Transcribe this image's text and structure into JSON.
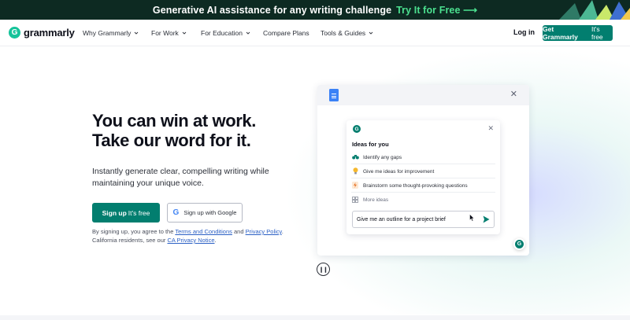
{
  "banner": {
    "text": "Generative AI assistance for any writing challenge",
    "cta": "Try It for Free ⟶"
  },
  "nav": {
    "logo_mark": "G",
    "logo_text": "grammarly",
    "items": [
      {
        "label": "Why Grammarly",
        "has_dropdown": true
      },
      {
        "label": "For Work",
        "has_dropdown": true
      },
      {
        "label": "For Education",
        "has_dropdown": true
      },
      {
        "label": "Compare Plans",
        "has_dropdown": false
      },
      {
        "label": "Tools & Guides",
        "has_dropdown": true
      }
    ],
    "login": "Log in",
    "cta_bold": "Get Grammarly",
    "cta_light": "It's free"
  },
  "hero": {
    "headline_line1": "You can win at work.",
    "headline_line2": "Take our word for it.",
    "subtext": "Instantly generate clear, compelling writing while maintaining your unique voice.",
    "signup_bold": "Sign up",
    "signup_light": "It's free",
    "google_label": "Sign up with Google",
    "legal": {
      "p1": "By signing up, you agree to the ",
      "terms": "Terms and Conditions",
      "p2": " and ",
      "privacy": "Privacy Policy",
      "p3": ". California residents, see our ",
      "ca": "CA Privacy Notice",
      "p4": "."
    }
  },
  "demo": {
    "panel_mark": "G",
    "ideas_title": "Ideas for you",
    "ideas": [
      {
        "icon": "binoculars-icon",
        "glyph": "⌁",
        "label": "Identify any gaps"
      },
      {
        "icon": "lightbulb-icon",
        "glyph": "💡",
        "label": "Give me ideas for improvement"
      },
      {
        "icon": "lightning-icon",
        "glyph": "⚡",
        "label": "Brainstorm some thought-provoking questions"
      },
      {
        "icon": "grid-icon",
        "glyph": "⊞",
        "label": "More ideas"
      }
    ],
    "prompt_value": "Give me an outline for a project brief",
    "float_mark": "G"
  },
  "colors": {
    "banner_bg": "#0d2a22",
    "banner_cta": "#4be08f",
    "brand_green": "#027e6f",
    "logo_green": "#15c39a"
  }
}
